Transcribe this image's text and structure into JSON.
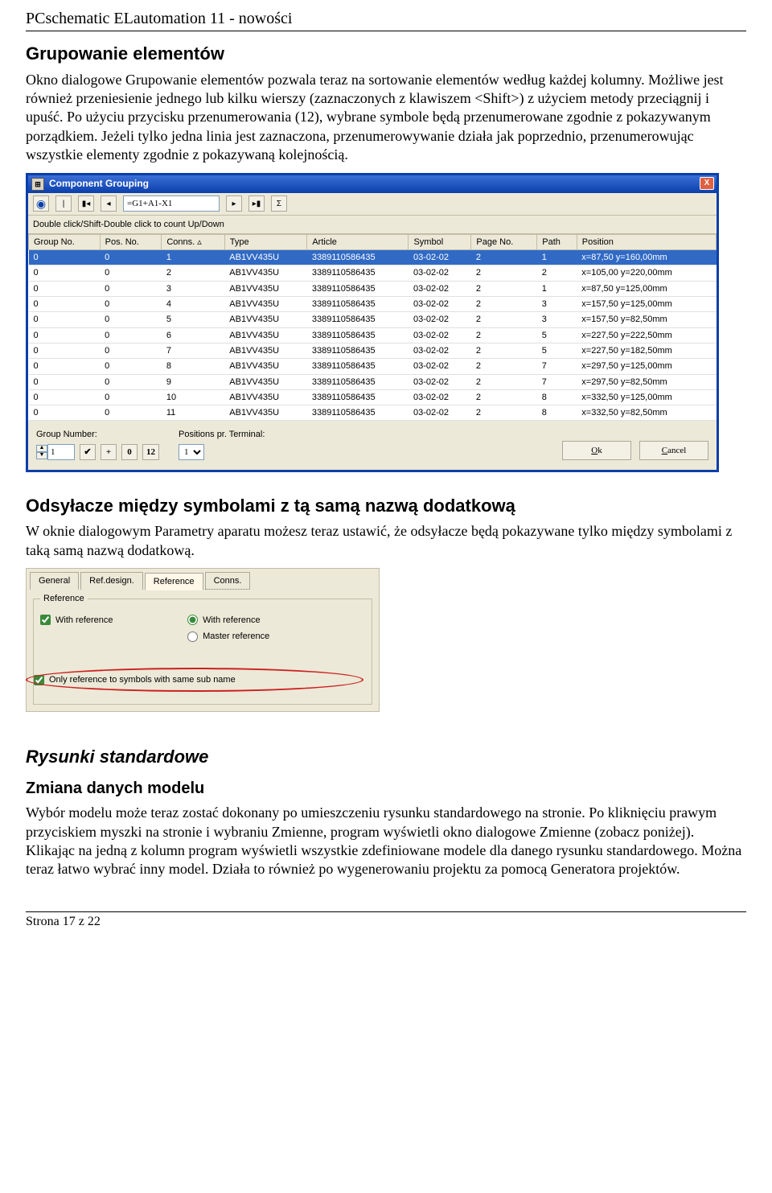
{
  "doc": {
    "header": "PCschematic ELautomation 11 - nowości",
    "footer": "Strona 17 z 22"
  },
  "section1": {
    "title": "Grupowanie elementów",
    "para": "Okno dialogowe Grupowanie elementów pozwala teraz na sortowanie elementów według każdej kolumny. Możliwe jest również przeniesienie jednego lub kilku wierszy (zaznaczonych z klawiszem <Shift>) z użyciem metody przeciągnij i upuść. Po użyciu przycisku przenumerowania (12), wybrane symbole będą przenumerowane zgodnie z pokazywanym porządkiem. Jeżeli tylko jedna linia jest zaznaczona, przenumerowywanie działa jak poprzednio, przenumerowując wszystkie elementy zgodnie z pokazywaną kolejnością."
  },
  "cg": {
    "title": "Component Grouping",
    "formula": "=G1+A1-X1",
    "hint": "Double click/Shift-Double click to count Up/Down",
    "headers": [
      "Group No.",
      "Pos. No.",
      "Conns.  ▵",
      "Type",
      "Article",
      "Symbol",
      "Page No.",
      "Path",
      "Position"
    ],
    "rows": [
      [
        "0",
        "0",
        "1",
        "AB1VV435U",
        "3389110586435",
        "03-02-02",
        "2",
        "1",
        "x=87,50 y=160,00mm"
      ],
      [
        "0",
        "0",
        "2",
        "AB1VV435U",
        "3389110586435",
        "03-02-02",
        "2",
        "2",
        "x=105,00 y=220,00mm"
      ],
      [
        "0",
        "0",
        "3",
        "AB1VV435U",
        "3389110586435",
        "03-02-02",
        "2",
        "1",
        "x=87,50 y=125,00mm"
      ],
      [
        "0",
        "0",
        "4",
        "AB1VV435U",
        "3389110586435",
        "03-02-02",
        "2",
        "3",
        "x=157,50 y=125,00mm"
      ],
      [
        "0",
        "0",
        "5",
        "AB1VV435U",
        "3389110586435",
        "03-02-02",
        "2",
        "3",
        "x=157,50 y=82,50mm"
      ],
      [
        "0",
        "0",
        "6",
        "AB1VV435U",
        "3389110586435",
        "03-02-02",
        "2",
        "5",
        "x=227,50 y=222,50mm"
      ],
      [
        "0",
        "0",
        "7",
        "AB1VV435U",
        "3389110586435",
        "03-02-02",
        "2",
        "5",
        "x=227,50 y=182,50mm"
      ],
      [
        "0",
        "0",
        "8",
        "AB1VV435U",
        "3389110586435",
        "03-02-02",
        "2",
        "7",
        "x=297,50 y=125,00mm"
      ],
      [
        "0",
        "0",
        "9",
        "AB1VV435U",
        "3389110586435",
        "03-02-02",
        "2",
        "7",
        "x=297,50 y=82,50mm"
      ],
      [
        "0",
        "0",
        "10",
        "AB1VV435U",
        "3389110586435",
        "03-02-02",
        "2",
        "8",
        "x=332,50 y=125,00mm"
      ],
      [
        "0",
        "0",
        "11",
        "AB1VV435U",
        "3389110586435",
        "03-02-02",
        "2",
        "8",
        "x=332,50 y=82,50mm"
      ]
    ],
    "groupNumberLabel": "Group Number:",
    "groupNumberValue": "1",
    "posLabel": "Positions pr. Terminal:",
    "posValue": "1",
    "btnCheck": "✔",
    "btnPlus": "+",
    "btn0": "0",
    "btn12": "12",
    "okLabel": "Ok",
    "cancelLabel": "Cancel"
  },
  "section2": {
    "title": "Odsyłacze między symbolami z tą samą nazwą dodatkową",
    "para": "W oknie dialogowym Parametry aparatu możesz teraz ustawić, że odsyłacze będą pokazywane tylko między symbolami z taką samą nazwą dodatkową."
  },
  "ref": {
    "tabs": [
      "General",
      "Ref.design.",
      "Reference",
      "Conns."
    ],
    "legend": "Reference",
    "withRefCheck": "With reference",
    "withRefRadio": "With reference",
    "masterRefRadio": "Master reference",
    "onlySame": "Only reference to symbols with same sub name"
  },
  "section3": {
    "titleItalic": "Rysunki standardowe",
    "subTitle": "Zmiana danych modelu",
    "para": "Wybór modelu może teraz zostać dokonany po umieszczeniu rysunku standardowego na stronie. Po kliknięciu prawym przyciskiem myszki na stronie i wybraniu Zmienne, program wyświetli okno dialogowe Zmienne (zobacz poniżej). Klikając na jedną z kolumn program wyświetli wszystkie zdefiniowane modele dla danego rysunku standardowego. Można teraz łatwo wybrać inny model. Działa to również po wygenerowaniu projektu za pomocą Generatora projektów."
  }
}
